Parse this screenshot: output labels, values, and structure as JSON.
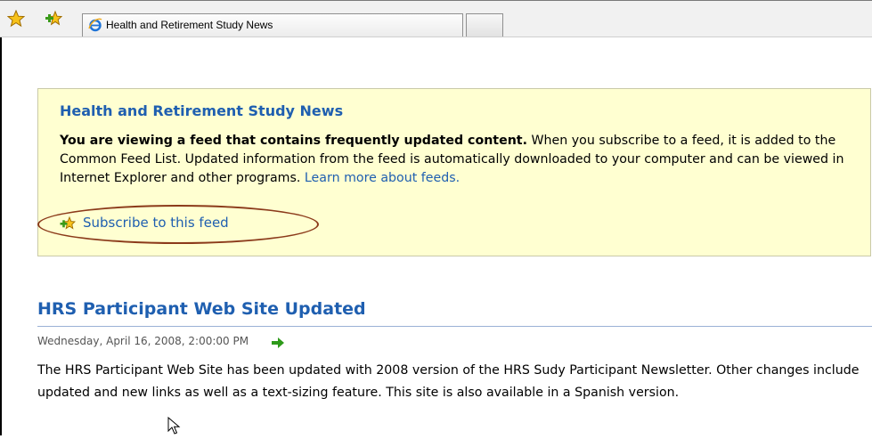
{
  "browser": {
    "tab_title": "Health and Retirement Study News",
    "icons": [
      "favorites-star-icon",
      "add-favorites-icon",
      "ie-logo-icon"
    ]
  },
  "feed_box": {
    "title": "Health and Retirement Study News",
    "lead": "You are viewing a feed that contains frequently updated content.",
    "description": " When you subscribe to a feed, it is added to the Common Feed List. Updated information from the feed is automatically downloaded to your computer and can be viewed in Internet Explorer and other programs. ",
    "learn_more": "Learn more about feeds.",
    "subscribe_label": "Subscribe to this feed",
    "highlight_color": "#8b3a1a"
  },
  "article": {
    "title": "HRS Participant Web Site Updated",
    "date": "Wednesday, April 16, 2008, 2:00:00 PM",
    "body": "The HRS Participant Web Site has been updated with 2008 version of the HRS Sudy Participant Newsletter. Other changes include updated and new links as well as a text-sizing feature. This site is also available in a Spanish version."
  },
  "colors": {
    "link": "#1f5fb0",
    "feed_background": "#ffffd1",
    "arrow": "#2e9a1a"
  }
}
